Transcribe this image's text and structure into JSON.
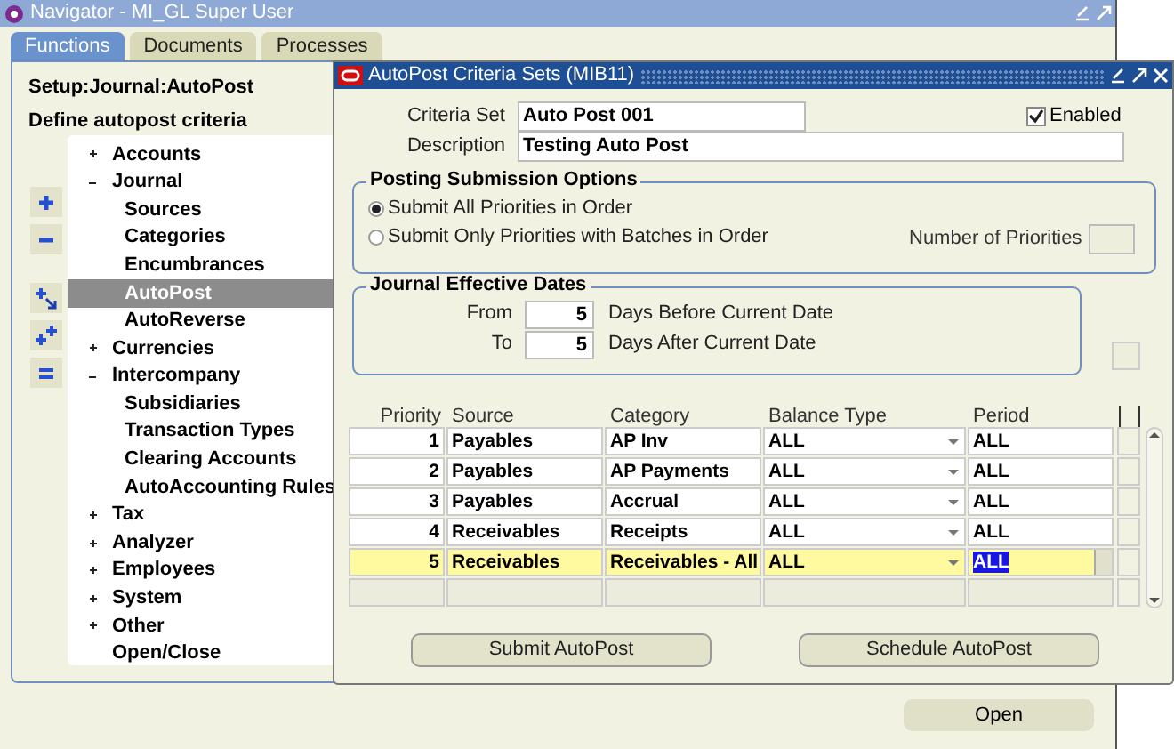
{
  "navigator": {
    "title": "Navigator - MI_GL Super User",
    "tabs": [
      {
        "label": "Functions",
        "selected": true
      },
      {
        "label": "Documents",
        "selected": false
      },
      {
        "label": "Processes",
        "selected": false
      }
    ],
    "path": "Setup:Journal:AutoPost",
    "description": "Define autopost criteria",
    "tree": [
      {
        "label": "Accounts",
        "expanded": false,
        "selected": false
      },
      {
        "label": "Journal",
        "expanded": true,
        "selected": false,
        "children": [
          {
            "label": "Sources",
            "selected": false
          },
          {
            "label": "Categories",
            "selected": false
          },
          {
            "label": "Encumbrances",
            "selected": false
          },
          {
            "label": "AutoPost",
            "selected": true
          },
          {
            "label": "AutoReverse",
            "selected": false
          }
        ]
      },
      {
        "label": "Currencies",
        "expanded": false,
        "selected": false
      },
      {
        "label": "Intercompany",
        "expanded": true,
        "selected": false,
        "children": [
          {
            "label": "Subsidiaries",
            "selected": false
          },
          {
            "label": "Transaction Types",
            "selected": false
          },
          {
            "label": "Clearing Accounts",
            "selected": false
          },
          {
            "label": "AutoAccounting Rules",
            "selected": false
          }
        ]
      },
      {
        "label": "Tax",
        "expanded": false,
        "selected": false
      },
      {
        "label": "Analyzer",
        "expanded": false,
        "selected": false
      },
      {
        "label": "Employees",
        "expanded": false,
        "selected": false
      },
      {
        "label": "System",
        "expanded": false,
        "selected": false
      },
      {
        "label": "Other",
        "expanded": false,
        "selected": false
      },
      {
        "label": "Open/Close",
        "selected": false
      }
    ],
    "open_button": "Open"
  },
  "dialog": {
    "title": "AutoPost Criteria Sets (MIB11)",
    "criteria_set": {
      "label": "Criteria Set",
      "value": "Auto Post 001"
    },
    "enabled": {
      "label": "Enabled",
      "checked": true
    },
    "description": {
      "label": "Description",
      "value": "Testing Auto Post"
    },
    "posting_options": {
      "title": "Posting Submission Options",
      "options": [
        {
          "label": "Submit All Priorities in Order",
          "selected": true
        },
        {
          "label": "Submit Only Priorities with Batches in Order",
          "selected": false
        }
      ],
      "number_of_priorities": {
        "label": "Number of Priorities"
      }
    },
    "effective_dates": {
      "title": "Journal Effective Dates",
      "from": {
        "label": "From",
        "value": "5",
        "suffix": "Days Before Current Date"
      },
      "to": {
        "label": "To",
        "value": "5",
        "suffix": "Days After Current Date"
      }
    },
    "table": {
      "columns": [
        "Priority",
        "Source",
        "Category",
        "Balance Type",
        "Period"
      ],
      "rows": [
        {
          "priority": "1",
          "source": "Payables",
          "category": "AP Inv",
          "balance_type": "ALL",
          "period": "ALL",
          "selected": false
        },
        {
          "priority": "2",
          "source": "Payables",
          "category": "AP Payments",
          "balance_type": "ALL",
          "period": "ALL",
          "selected": false
        },
        {
          "priority": "3",
          "source": "Payables",
          "category": "Accrual",
          "balance_type": "ALL",
          "period": "ALL",
          "selected": false
        },
        {
          "priority": "4",
          "source": "Receivables",
          "category": "Receipts",
          "balance_type": "ALL",
          "period": "ALL",
          "selected": false
        },
        {
          "priority": "5",
          "source": "Receivables",
          "category": "Receivables - All",
          "balance_type": "ALL",
          "period": "ALL",
          "selected": true
        }
      ]
    },
    "buttons": [
      "Submit AutoPost",
      "Schedule AutoPost"
    ]
  }
}
